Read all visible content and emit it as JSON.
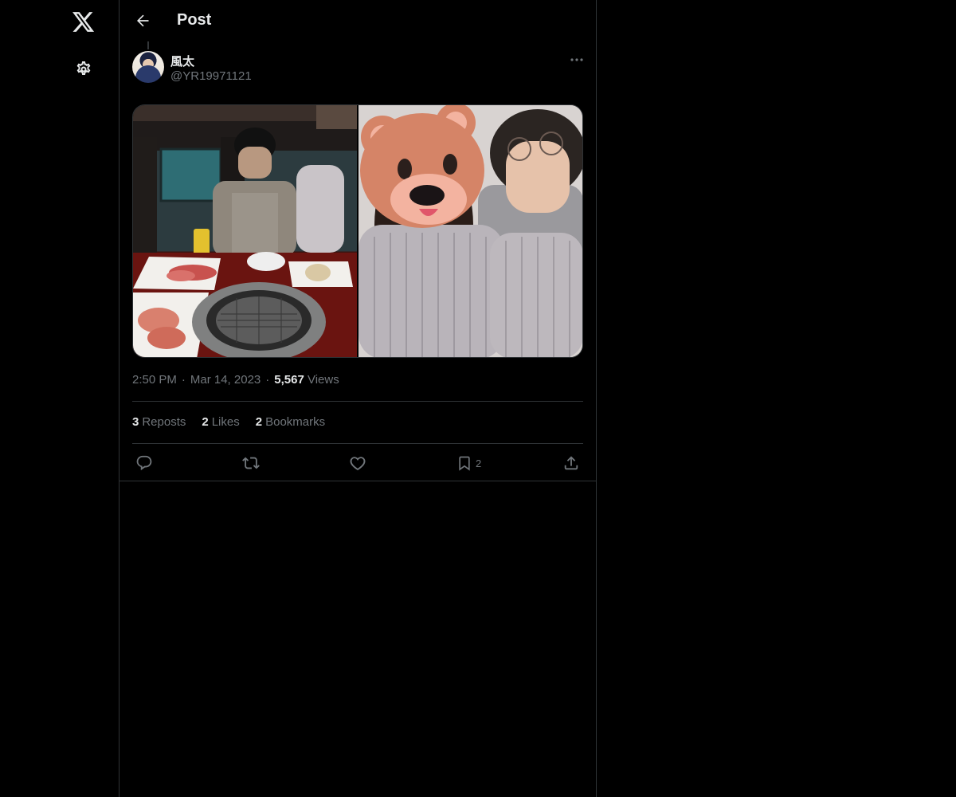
{
  "nav": {
    "logo_icon": "x-logo-icon",
    "settings_icon": "gear-icon"
  },
  "header": {
    "title": "Post",
    "back_icon": "arrow-left-icon"
  },
  "post": {
    "author_name": "風太",
    "author_handle": "@YR19971121",
    "more_icon": "more-horizontal-icon",
    "media": [
      {
        "kind": "photo",
        "subject": "yakiniku dinner"
      },
      {
        "kind": "photo",
        "subject": "selfie with bear sticker"
      }
    ],
    "time": "2:50 PM",
    "date": "Mar 14, 2023",
    "separator": "·",
    "views_count": "5,567",
    "views_label": "Views"
  },
  "stats": {
    "reposts_count": "3",
    "reposts_label": "Reposts",
    "likes_count": "2",
    "likes_label": "Likes",
    "bookmarks_count": "2",
    "bookmarks_label": "Bookmarks"
  },
  "actions": {
    "bookmark_count": "2"
  },
  "colors": {
    "background": "#000000",
    "text": "#e7e9ea",
    "muted": "#71767b",
    "border": "#2f3336"
  }
}
